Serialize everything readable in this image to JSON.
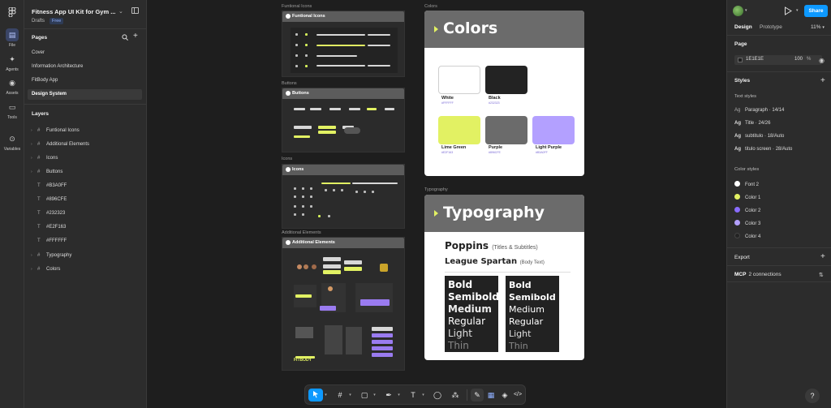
{
  "rail": {
    "items": [
      {
        "label": "File",
        "icon": "file-icon"
      },
      {
        "label": "Agents",
        "icon": "agents-icon"
      },
      {
        "label": "Assets",
        "icon": "assets-icon"
      },
      {
        "label": "Tools",
        "icon": "tools-icon"
      },
      {
        "label": "Variables",
        "icon": "variables-icon"
      }
    ]
  },
  "file": {
    "title": "Fitness App UI Kit for Gym ...",
    "location": "Drafts",
    "plan": "Free"
  },
  "pages": {
    "title": "Pages",
    "items": [
      "Cover",
      "Information Architecture",
      "FitBody App",
      "Design System"
    ],
    "active_index": 3
  },
  "layers": {
    "title": "Layers",
    "items": [
      {
        "name": "Funtional Icons",
        "kind": "frame"
      },
      {
        "name": "Additional Elements",
        "kind": "frame"
      },
      {
        "name": "Icons",
        "kind": "frame"
      },
      {
        "name": "Buttons",
        "kind": "frame"
      },
      {
        "name": "#B3A0FF",
        "kind": "text"
      },
      {
        "name": "#896CFE",
        "kind": "text"
      },
      {
        "name": "#232323",
        "kind": "text"
      },
      {
        "name": "#E2F163",
        "kind": "text"
      },
      {
        "name": "#FFFFFF",
        "kind": "text"
      },
      {
        "name": "Typography",
        "kind": "frame"
      },
      {
        "name": "Colors",
        "kind": "frame"
      }
    ]
  },
  "canvas": {
    "frames": {
      "functional_icons": {
        "label": "Funtional Icons",
        "header": "Funtional Icons"
      },
      "buttons": {
        "label": "Buttons",
        "header": "Buttons"
      },
      "icons": {
        "label": "Icons",
        "header": "Icons"
      },
      "additional": {
        "label": "Additional Elements",
        "header": "Additional Elements",
        "brand": "FITBODY"
      },
      "colors": {
        "label": "Colors",
        "title": "Colors",
        "swatches": [
          {
            "name": "White",
            "hex": "#FFFFFF",
            "color": "#ffffff"
          },
          {
            "name": "Black",
            "hex": "#232323",
            "color": "#232323"
          },
          {
            "name": "Lime Green",
            "hex": "#E2F163",
            "color": "#e2f163"
          },
          {
            "name": "Purple",
            "hex": "#896CFE",
            "color": "#6b6b6b"
          },
          {
            "name": "Light Purple",
            "hex": "#B3A0FF",
            "color": "#b3a0ff"
          }
        ]
      },
      "typography": {
        "label": "Typography",
        "title": "Typography",
        "font1": {
          "name": "Poppins",
          "note": "(Titles & Subtitles)"
        },
        "font2": {
          "name": "League Spartan",
          "note": "(Body Text)"
        },
        "weights": [
          "Bold",
          "Semibold",
          "Medium",
          "Regular",
          "Light",
          "Thin"
        ]
      }
    }
  },
  "toolbar": {
    "tools": [
      "move-icon",
      "frame-icon",
      "rectangle-icon",
      "pen-icon",
      "text-icon",
      "comment-icon",
      "components-icon",
      "draw-icon",
      "dev-mode-icon",
      "code-icon"
    ]
  },
  "right": {
    "share_label": "Share",
    "tabs": [
      "Design",
      "Prototype"
    ],
    "zoom": "11%",
    "page": {
      "title": "Page",
      "color_hex": "1E1E1E",
      "opacity": "100",
      "unit": "%"
    },
    "styles": {
      "title": "Styles",
      "text_styles_title": "Text styles",
      "text_styles": [
        {
          "name": "Paragraph",
          "meta": "14/14",
          "bold": false
        },
        {
          "name": "Title",
          "meta": "24/26",
          "bold": true
        },
        {
          "name": "subtitulo",
          "meta": "18/Auto",
          "bold": true
        },
        {
          "name": "titulo screen",
          "meta": "28/Auto",
          "bold": true
        }
      ],
      "color_styles_title": "Color styles",
      "color_styles": [
        {
          "name": "Font 2",
          "color": "#ffffff"
        },
        {
          "name": "Color 1",
          "color": "#e2f163"
        },
        {
          "name": "Color 2",
          "color": "#896cfe"
        },
        {
          "name": "Color 3",
          "color": "#b3a0ff"
        },
        {
          "name": "Color 4",
          "color": "#232323"
        }
      ]
    },
    "export_title": "Export",
    "mcp": {
      "label": "MCP",
      "status": "2 connections"
    },
    "help": "?"
  }
}
